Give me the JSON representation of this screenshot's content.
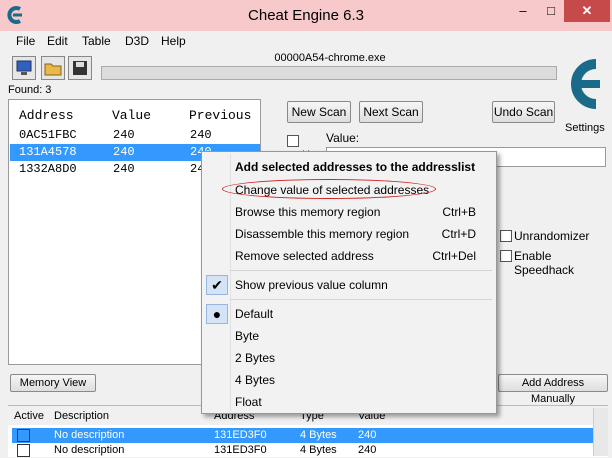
{
  "window": {
    "title": "Cheat Engine 6.3",
    "min_label": "–",
    "max_label": "□",
    "close_label": "✕"
  },
  "menu": [
    "File",
    "Edit",
    "Table",
    "D3D",
    "Help"
  ],
  "process": {
    "name": "00000A54-chrome.exe"
  },
  "found": "Found: 3",
  "scan_list": {
    "headers": [
      "Address",
      "Value",
      "Previous"
    ],
    "rows": [
      {
        "address": "0AC51FBC",
        "value": "240",
        "previous": "240"
      },
      {
        "address": "131A4578",
        "value": "240",
        "previous": "240"
      },
      {
        "address": "1332A8D0",
        "value": "240",
        "previous": "24"
      }
    ]
  },
  "buttons": {
    "new_scan": "New Scan",
    "next_scan": "Next Scan",
    "undo_scan": "Undo Scan",
    "settings": "Settings",
    "memory_view": "Memory View",
    "add_manual": "Add Address Manually"
  },
  "value_label": "Value:",
  "value_fragment": "Ha",
  "options": {
    "unrandomizer": "Unrandomizer",
    "speedhack": "Enable Speedhack"
  },
  "bottom": {
    "headers": [
      "Active",
      "Description",
      "Address",
      "Type",
      "Value"
    ],
    "rows": [
      {
        "description": "No description",
        "address": "131ED3F0",
        "type": "4 Bytes",
        "value": "240"
      },
      {
        "description": "No description",
        "address": "131ED3F0",
        "type": "4 Bytes",
        "value": "240"
      }
    ]
  },
  "context_menu": {
    "add_selected": "Add selected addresses to the addresslist",
    "change_value": "Change value of selected addresses",
    "browse": {
      "label": "Browse this memory region",
      "shortcut": "Ctrl+B"
    },
    "disassemble": {
      "label": "Disassemble this memory region",
      "shortcut": "Ctrl+D"
    },
    "remove": {
      "label": "Remove selected address",
      "shortcut": "Ctrl+Del"
    },
    "show_previous": "Show previous value column",
    "types": [
      "Default",
      "Byte",
      "2 Bytes",
      "4 Bytes",
      "Float"
    ]
  },
  "colors": {
    "selection": "#3399ff",
    "title_bar": "#f8c9cb",
    "highlight_ring": "#d02020"
  }
}
